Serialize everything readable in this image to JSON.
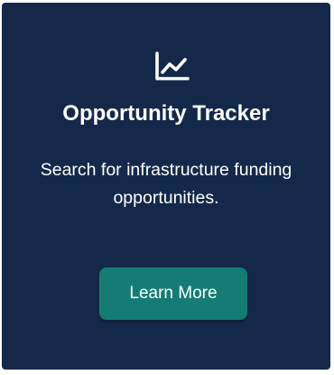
{
  "card": {
    "icon": "line-chart-icon",
    "title": "Opportunity Tracker",
    "description": "Search for infrastructure funding opportunities.",
    "button_label": "Learn More"
  },
  "colors": {
    "card_background": "#14294a",
    "button_background": "#157c75",
    "text": "#ffffff"
  }
}
